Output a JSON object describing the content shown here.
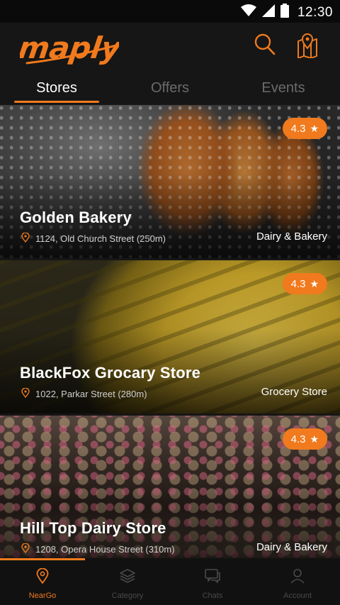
{
  "status_bar": {
    "time": "12:30"
  },
  "app": {
    "logo_text": "maply"
  },
  "header": {
    "icons": [
      "search-icon",
      "map-pin-icon"
    ]
  },
  "tabs": [
    {
      "label": "Stores",
      "active": true
    },
    {
      "label": "Offers",
      "active": false
    },
    {
      "label": "Events",
      "active": false
    }
  ],
  "stores": [
    {
      "name": "Golden Bakery",
      "address": "1124, Old Church Street (250m)",
      "category": "Dairy & Bakery",
      "rating": "4.3"
    },
    {
      "name": "BlackFox Grocary Store",
      "address": "1022, Parkar Street (280m)",
      "category": "Grocery Store",
      "rating": "4.3"
    },
    {
      "name": "Hill Top Dairy Store",
      "address": "1208, Opera House Street (310m)",
      "category": "Dairy & Bakery",
      "rating": "4.3"
    }
  ],
  "bottom_nav": [
    {
      "label": "NearGo",
      "icon": "location-pin-icon",
      "active": true
    },
    {
      "label": "Category",
      "icon": "layers-icon",
      "active": false
    },
    {
      "label": "Chats",
      "icon": "chat-icon",
      "active": false
    },
    {
      "label": "Account",
      "icon": "user-icon",
      "active": false
    }
  ],
  "colors": {
    "accent": "#f07a1d",
    "background": "#161616",
    "inactive": "#4a4a4a"
  }
}
